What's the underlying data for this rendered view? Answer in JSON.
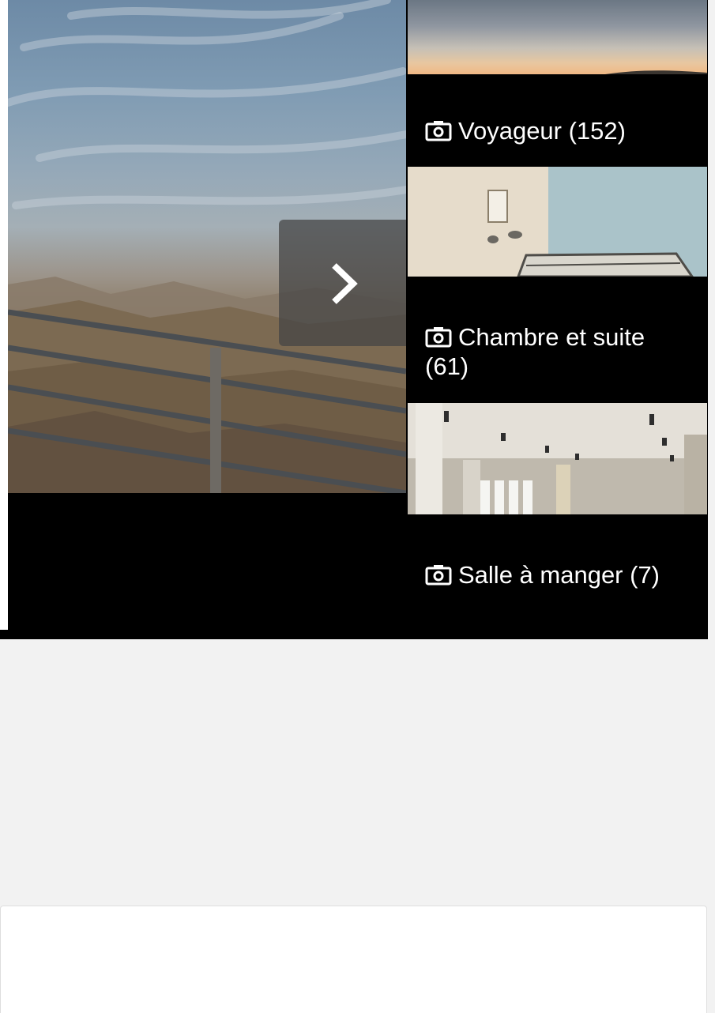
{
  "gallery": {
    "hero": {
      "alt": "desert canyon viewpoint with railing",
      "next_icon": "chevron-right-icon"
    },
    "categories": [
      {
        "icon": "camera-icon",
        "label": "Voyageur (152)"
      },
      {
        "icon": "camera-icon",
        "label": "Chambre et suite (61)"
      },
      {
        "icon": "camera-icon",
        "label": "Salle à manger (7)"
      }
    ]
  },
  "colors": {
    "page_background": "#f2f2f2",
    "gallery_background": "#000000",
    "label_text": "#ffffff",
    "arrow_overlay": "#464646"
  }
}
